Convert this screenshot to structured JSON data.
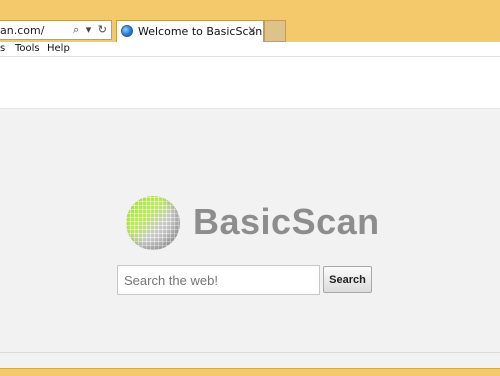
{
  "browser": {
    "address_text": "an.com/",
    "tab_title": "Welcome to BasicScan",
    "tab_close": "×",
    "accent_color": "#f3c96c"
  },
  "addr_icons": {
    "search": "⌕",
    "dropdown": "▾",
    "refresh": "↻"
  },
  "menubar": {
    "items": [
      {
        "label": "s"
      },
      {
        "label": "Tools"
      },
      {
        "label": "Help"
      }
    ]
  },
  "page": {
    "logo_text": "BasicScan",
    "search_placeholder": "Search the web!",
    "search_value": "",
    "search_button": "Search"
  }
}
